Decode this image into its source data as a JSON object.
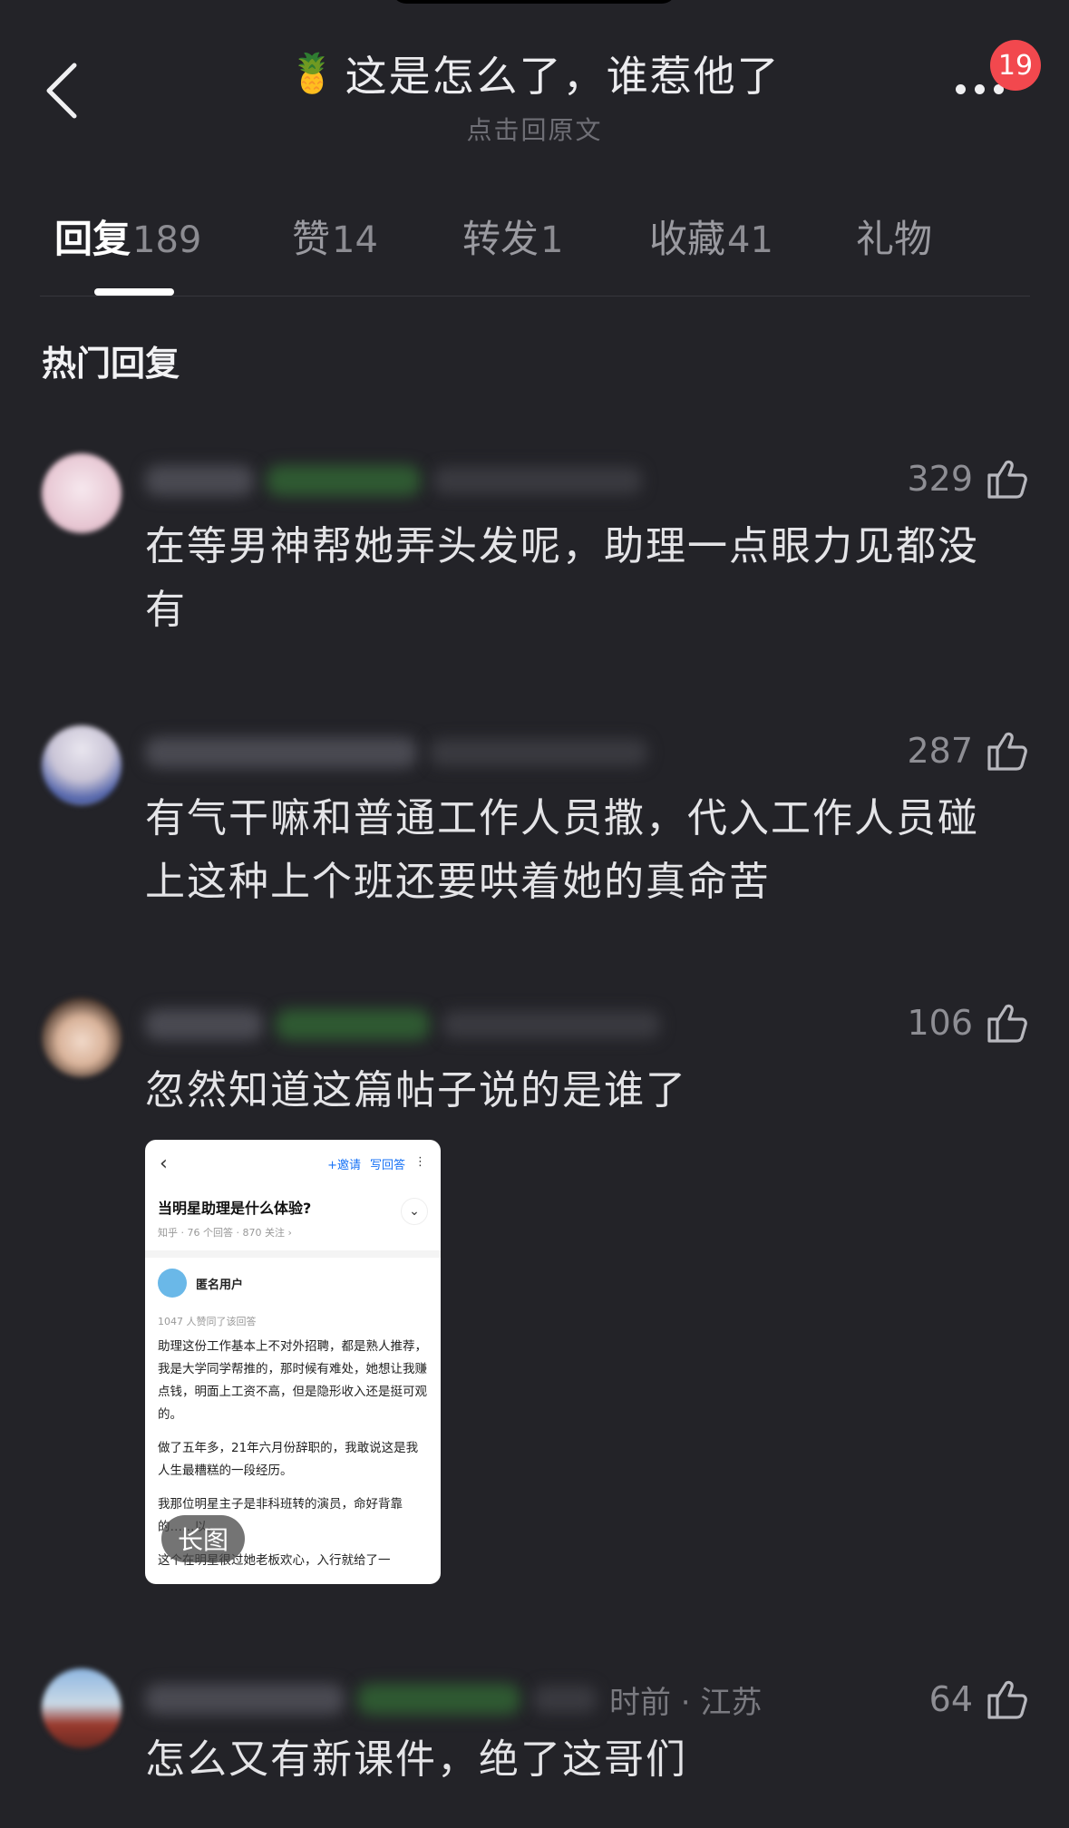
{
  "header": {
    "title_emoji": "🍍",
    "title": "这是怎么了，谁惹他了",
    "subtitle": "点击回原文",
    "notification_badge": "19"
  },
  "tabs": [
    {
      "label": "回复",
      "count": "189",
      "active": true
    },
    {
      "label": "赞",
      "count": "14",
      "active": false
    },
    {
      "label": "转发",
      "count": "1",
      "active": false
    },
    {
      "label": "收藏",
      "count": "41",
      "active": false
    },
    {
      "label": "礼物",
      "count": "",
      "active": false
    }
  ],
  "section_title": "热门回复",
  "comments": [
    {
      "likes": "329",
      "text": "在等男神帮她弄头发呢，助理一点眼力见都没有"
    },
    {
      "likes": "287",
      "text": "有气干嘛和普通工作人员撒，代入工作人员碰上这种上个班还要哄着她的真命苦"
    },
    {
      "likes": "106",
      "text": "忽然知道这篇帖子说的是谁了",
      "image": {
        "top_actions": [
          "+邀请",
          "写回答"
        ],
        "question": "当明星助理是什么体验?",
        "question_meta": "知乎 · 76 个回答 · 870 关注 ›",
        "author": "匿名用户",
        "agree": "1047 人赞同了该回答",
        "paragraphs": [
          "助理这份工作基本上不对外招聘，都是熟人推荐，我是大学同学帮推的，那时候有难处，她想让我赚点钱，明面上工资不高，但是隐形收入还是挺可观的。",
          "做了五年多，21年六月份辞职的，我敢说这是我人生最糟糕的一段经历。",
          "我那位明星主子是非科班转的演员，命好背靠的……以。",
          "这个在明星很过她老板欢心，入行就给了一"
        ],
        "long_image_label": "长图"
      }
    },
    {
      "likes": "64",
      "meta_visible": "时前 · 江苏",
      "text": "怎么又有新课件，绝了这哥们"
    }
  ],
  "colors": {
    "background": "#232328",
    "badge": "#f2484e",
    "tag_green": "#2f5a32",
    "link_blue": "#1772f6"
  }
}
